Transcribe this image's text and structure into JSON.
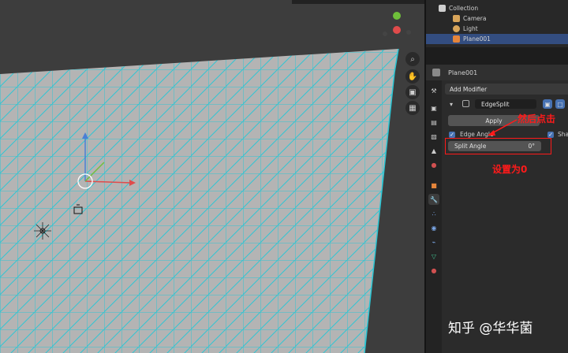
{
  "outliner": {
    "rows": [
      {
        "label": "Collection"
      },
      {
        "label": "Camera"
      },
      {
        "label": "Light"
      },
      {
        "label": "Plane001"
      }
    ]
  },
  "properties": {
    "object_name": "Plane001",
    "add_modifier_label": "Add Modifier",
    "modifier_name": "EdgeSplit",
    "apply_label": "Apply",
    "edge_angle_label": "Edge Angle",
    "sharp_label": "Sha",
    "split_angle_label": "Split Angle",
    "split_angle_value": "0°"
  },
  "annotations": {
    "click_note": "然后点击",
    "set_note": "设置为0"
  },
  "watermark": "知乎 @华华菌",
  "colors": {
    "wire": "#27c9d6",
    "face": "#b7b7b7",
    "selected_row": "#334d80",
    "annotation": "#ff1a1a"
  }
}
